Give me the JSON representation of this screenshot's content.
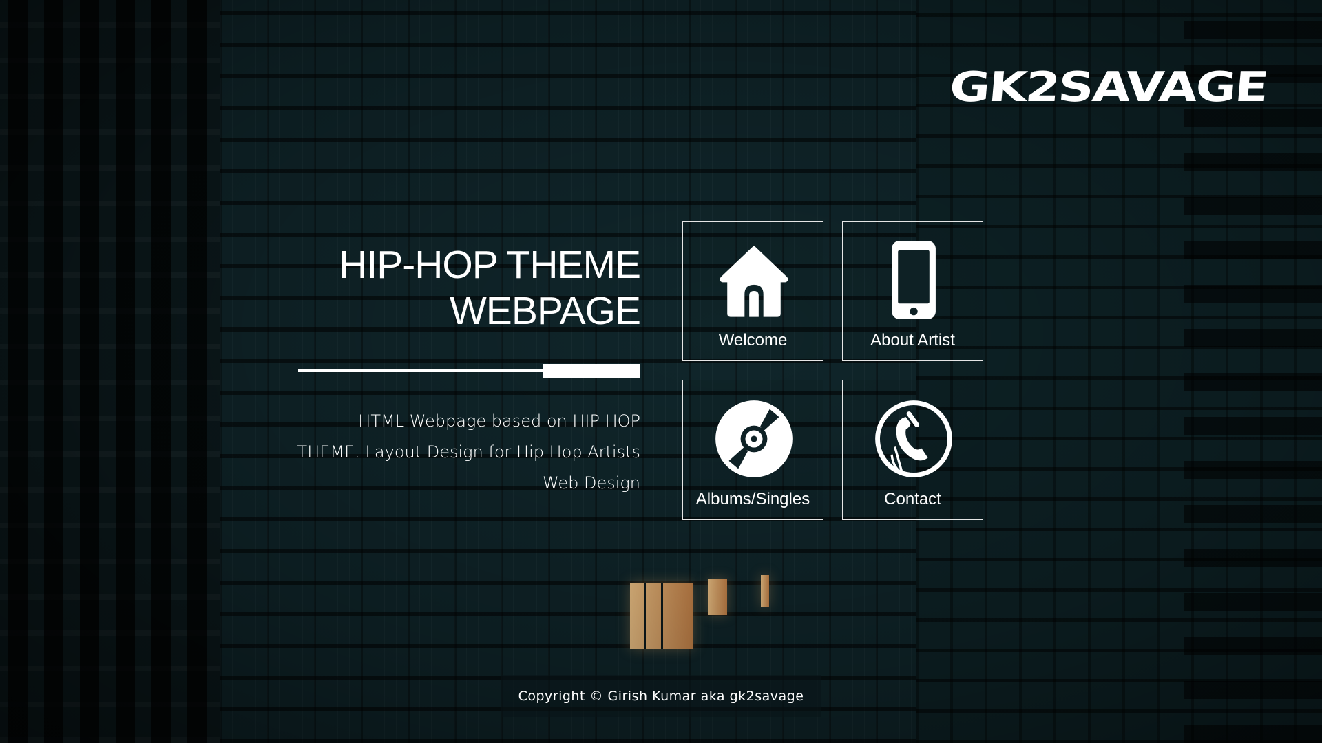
{
  "logo": {
    "text": "GK2SAVAGE"
  },
  "hero": {
    "title_line1": "HIP-HOP THEME",
    "title_line2": "WEBPAGE",
    "desc_line1": "HTML Webpage based on HIP HOP",
    "desc_line2": "THEME. Layout Design for Hip Hop Artists",
    "desc_line3": "Web Design"
  },
  "tiles": [
    {
      "label": "Welcome",
      "icon": "home-icon"
    },
    {
      "label": "About Artist",
      "icon": "smartphone-icon"
    },
    {
      "label": "Albums/Singles",
      "icon": "vinyl-record-icon"
    },
    {
      "label": "Contact",
      "icon": "phone-handset-icon"
    }
  ],
  "footer": {
    "copyright": "Copyright © Girish Kumar aka gk2savage"
  },
  "colors": {
    "text": "#ffffff",
    "background": "#0d1e22",
    "window_light": "#f5c88a"
  }
}
